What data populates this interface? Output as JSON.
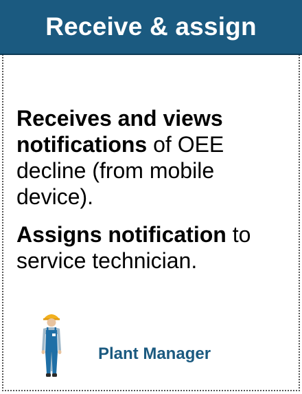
{
  "header": {
    "title": "Receive & assign",
    "bg_color": "#1b5a80"
  },
  "body": {
    "para1": {
      "bold": "Receives and views notifications",
      "rest": " of OEE decline (from mobile device)."
    },
    "para2": {
      "bold": "Assigns notification",
      "rest": " to service technician."
    }
  },
  "role": {
    "icon": "worker-icon",
    "label": "Plant Manager",
    "color": "#1b5a80"
  }
}
